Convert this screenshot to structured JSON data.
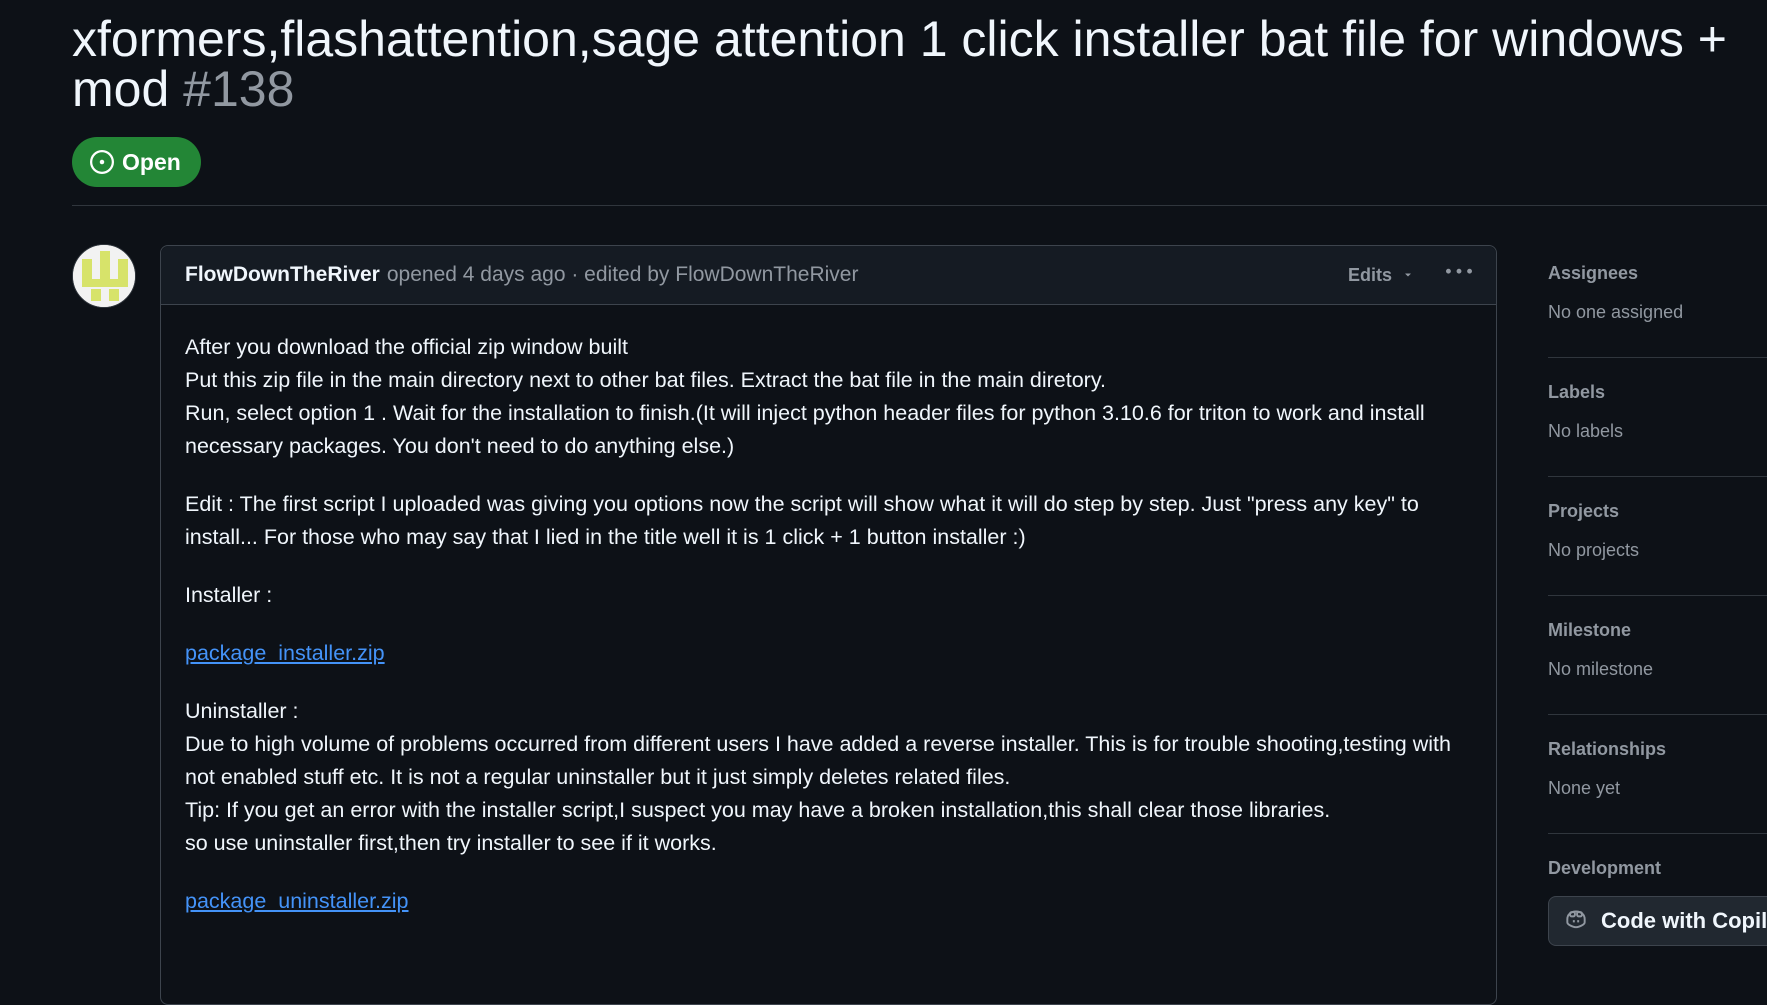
{
  "issue": {
    "title": "xformers,flashattention,sage attention 1 click installer bat file for windows + mod",
    "number": "#138",
    "state": "Open",
    "state_color": "#238636"
  },
  "comment": {
    "author": "FlowDownTheRiver",
    "meta": "opened 4 days ago · edited by FlowDownTheRiver",
    "edits_label": "Edits",
    "body": {
      "line1": "After you download the official zip window built",
      "line2": "Put this zip file in the main directory next to other bat files. Extract the bat file in the main diretory.",
      "line3": "Run, select option 1 . Wait for the installation to finish.(It will inject python header files for python 3.10.6 for triton to work and install necessary packages. You don't need to do anything else.)",
      "edit_note": "Edit : The first script I uploaded was giving you options now the script will show what it will do step by step. Just \"press any key\" to install... For those who may say that I lied in the title well it is 1 click + 1 button installer :)",
      "installer_label": "Installer :",
      "installer_link": "package_installer.zip",
      "uninstaller_label": "Uninstaller :",
      "uninstaller_desc": "Due to high volume of problems occurred from different users I have added a reverse installer. This is for trouble shooting,testing with not enabled stuff etc. It is not a regular uninstaller but it just simply deletes related files.",
      "tip": "Tip: If you get an error with the installer script,I suspect you may have a broken installation,this shall clear those libraries.",
      "tip2": "so use uninstaller first,then try installer to see if it works.",
      "uninstaller_link": "package_uninstaller.zip"
    }
  },
  "sidebar": {
    "assignees": {
      "heading": "Assignees",
      "value": "No one assigned"
    },
    "labels": {
      "heading": "Labels",
      "value": "No labels"
    },
    "projects": {
      "heading": "Projects",
      "value": "No projects"
    },
    "milestone": {
      "heading": "Milestone",
      "value": "No milestone"
    },
    "relationships": {
      "heading": "Relationships",
      "value": "None yet"
    },
    "development": {
      "heading": "Development",
      "button": "Code with Copilot Agent Mode"
    }
  },
  "icons": {
    "state": "issue-opened-icon",
    "edits": "triangle-down-icon",
    "more": "kebab-horizontal-icon",
    "copilot": "copilot-icon"
  }
}
